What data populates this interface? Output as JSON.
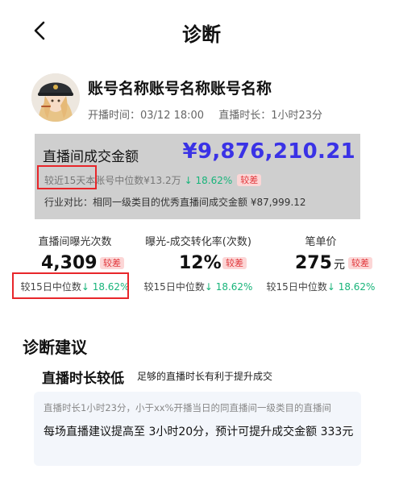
{
  "header": {
    "title": "诊断"
  },
  "account": {
    "name": "账号名称账号名称账号名称",
    "start_time": "开播时间：03/12 18:00",
    "duration": "直播时长：1小时23分"
  },
  "gmv": {
    "label": "直播间成交金额",
    "value": "¥9,876,210.21",
    "compare_text": "较近15天本账号中位数¥13.2万",
    "compare_change": "↓ 18.62%",
    "tag": "较差",
    "industry": "行业对比：相同一级类目的优秀直播间成交金额 ¥87,999.12"
  },
  "metrics": [
    {
      "title": "直播间曝光次数",
      "value": "4,309",
      "unit": "",
      "tag": "较差",
      "compare_text": "较15日中位数",
      "compare_change": "↓ 18.62%"
    },
    {
      "title": "曝光-成交转化率(次数)",
      "value": "12%",
      "unit": "",
      "tag": "较差",
      "compare_text": "较15日中位数",
      "compare_change": "↓ 18.62%"
    },
    {
      "title": "笔单价",
      "value": "275",
      "unit": "元",
      "tag": "较差",
      "compare_text": "较15日中位数",
      "compare_change": "↓ 18.62%"
    }
  ],
  "advice": {
    "section_title": "诊断建议",
    "title": "直播时长较低",
    "subtitle": "足够的直播时长有利于提升成交",
    "description": "直播时长1小时23分，小于xx%开播当日的同直播间一级类目的直播间",
    "suggestion": "每场直播建议提高至 3小时20分，预计可提升成交金额 333元"
  },
  "colors": {
    "accent_blue": "#3a32e6",
    "down_green": "#18b47a",
    "tag_red": "#e0363a",
    "highlight_box": "#e8262a"
  }
}
